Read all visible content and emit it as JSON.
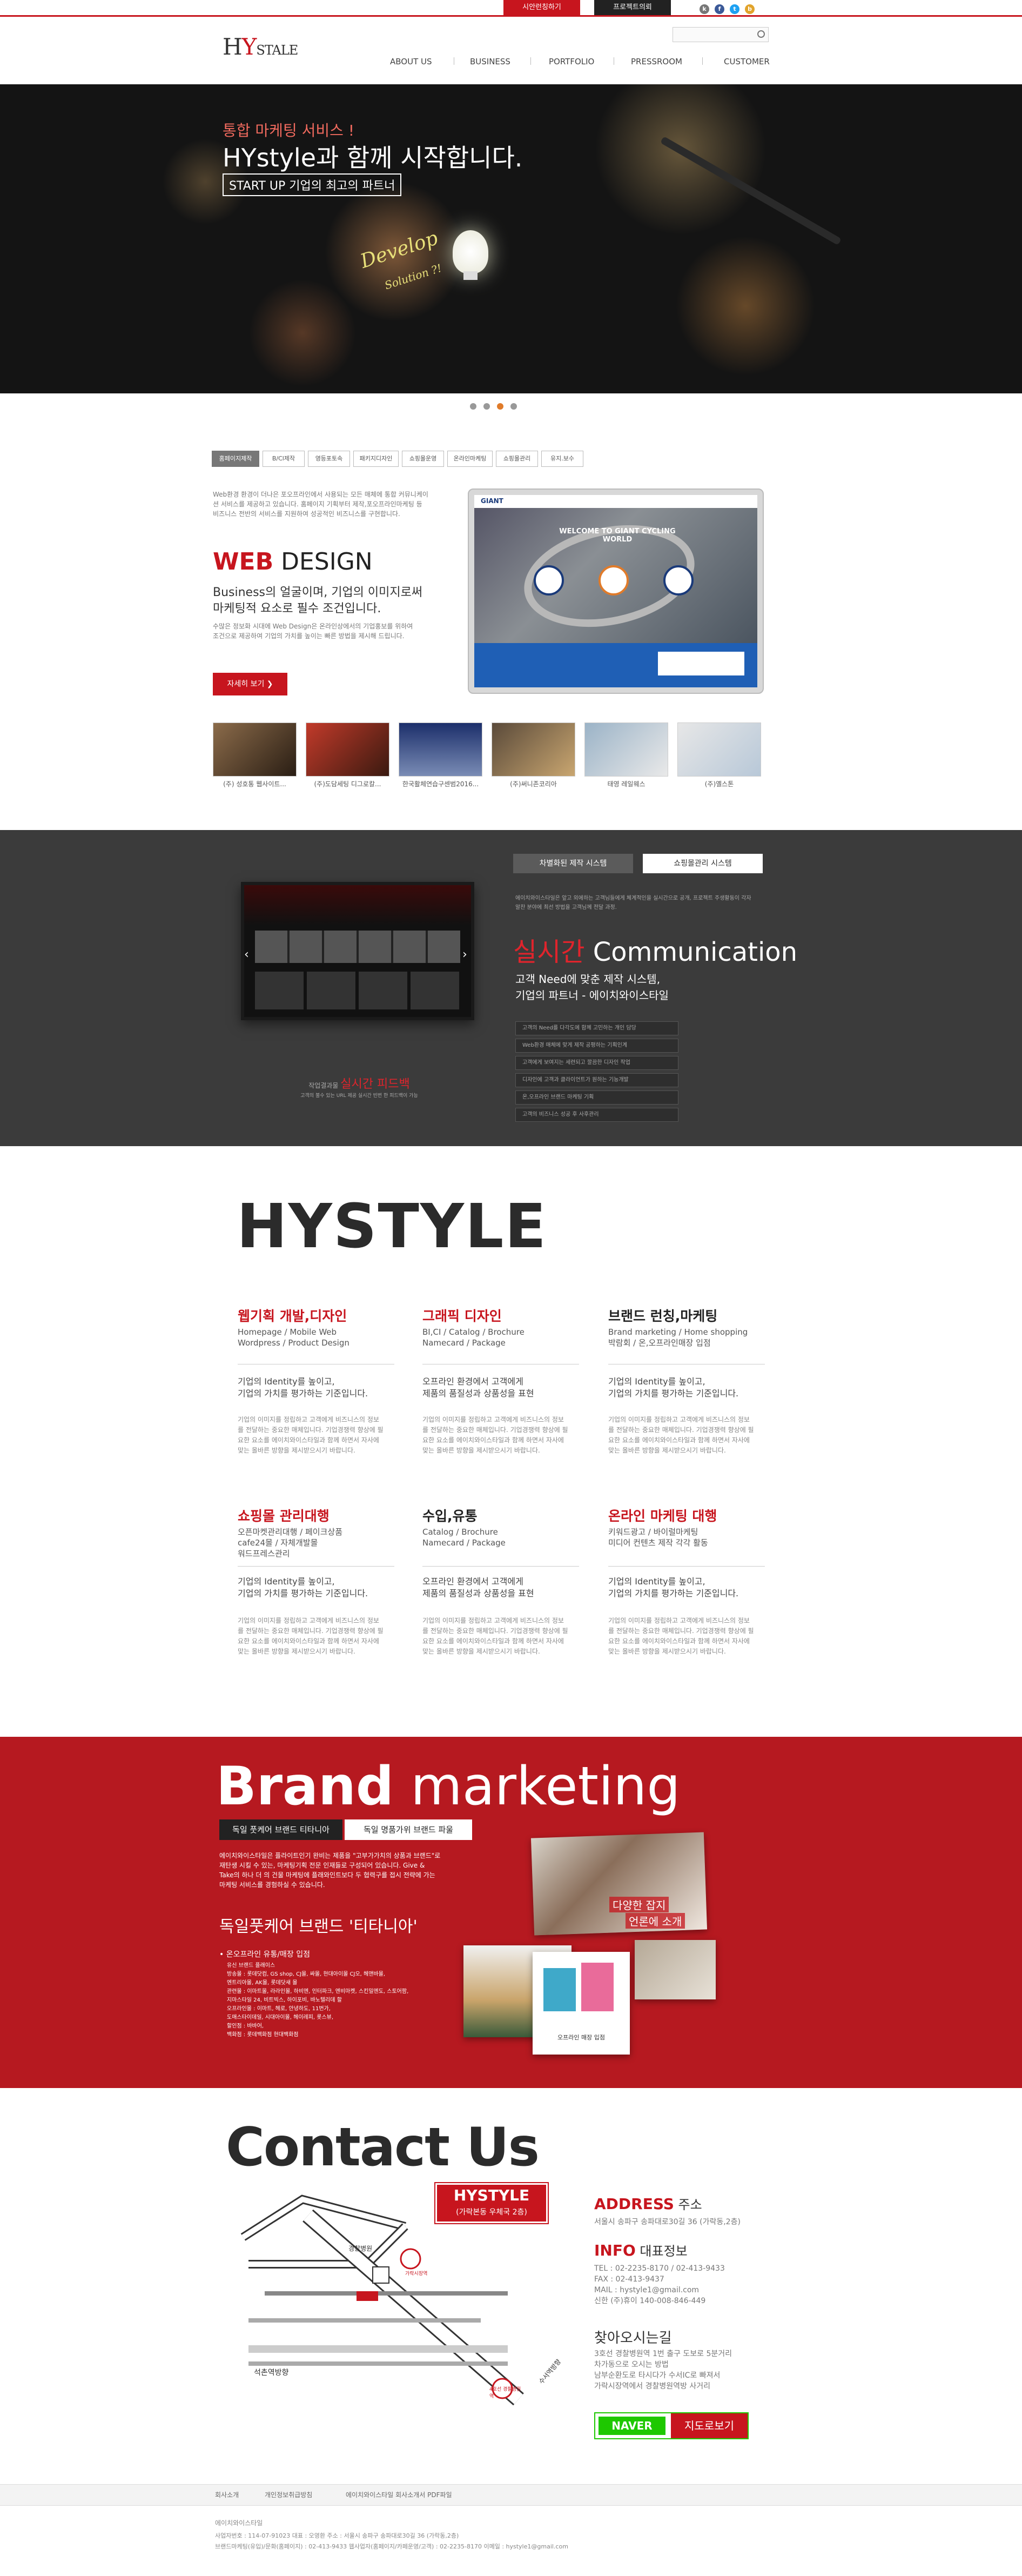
{
  "topbar": {
    "btn1": "시안런칭하기",
    "btn2": "프로젝트의뢰"
  },
  "header": {
    "logo": "HYSTYLE",
    "logo_sub": "hystyle",
    "nav": [
      "ABOUT US",
      "BUSINESS",
      "PORTFOLIO",
      "PRESSROOM",
      "CUSTOMER"
    ]
  },
  "hero": {
    "line1": "통합 마케팅 서비스 !",
    "line2": "HYstyle과 함께 시작합니다.",
    "line3": "START UP 기업의 최고의 파트너",
    "chalk": "Develop",
    "chalk2": "Solution ?!"
  },
  "web": {
    "tabs": [
      "홈페이지제작",
      "B/Cl제작",
      "영등포토속",
      "패키지디자인",
      "쇼핑몰운영",
      "온라인마케팅",
      "쇼핑몰관리",
      "유지.보수"
    ],
    "intro": "Web환경 환경이 더나은 포오프라인에서 사용되는 모든 매체에 통합 커뮤니케이션 서비스를 제공하고 있습니다. 홈페이지 기획부터 제작,포오프라인마케팅 등 비즈니스 전반의 서비스를 지원하여 성공적인 비즈니스를 구현합니다.",
    "title_red": "WEB",
    "title_rest": " DESIGN",
    "subtitle1": "Business의 얼굴이며, 기업의 이미지로써",
    "subtitle2": "마케팅적 요소로 필수 조건입니다.",
    "desc": "수많은 정보화 시대에 Web Design은 온라인상에서의 기업홍보를 위하여 조건으로 제공하여 기업의 가치를 높이는 빠른 방법을 제시해 드립니다.",
    "more": "자세히 보기 ❯",
    "screen_title": "WELCOME TO GIANT CYCLING WORLD",
    "screen_logo": "GIANT",
    "thumbs": [
      "(주) 성호통 웹사이트...",
      "(주)도담세팅 디그로칼...",
      "한국활체연습구센범2016...",
      "(주)써니존코리아",
      "태영 레일웨스",
      "(주)옐스톤"
    ]
  },
  "dark": {
    "tab1": "차별화된 제작 시스템",
    "tab2": "쇼핑몰관리 시스템",
    "desc": "에이치와이스타일은 앞고 외에하는 고객님들에게 체계적인을 실시간으로 공개, 프로젝트 주생활동이 각자 알찬 분야에 최선 방법을 고객님께 전달 과정.",
    "title_red": "실시간",
    "title_rest": " Communication",
    "sub1": "고객 Need에 맞춘 제작 시스템,",
    "sub2": "기업의 파트너 - 에이치와이스타일",
    "list": [
      "고객의 Need를 다각도에 함께 고민하는 개인 담당",
      "Web환경 매체에 맞게 제작 공평하는 기획인계",
      "고객에게 보여지는 세련되고 깔끔한 디자인 작업",
      "디자인에 고객과 클라이언트가 원하는 기능개발",
      "온,오프라인 브랜드 마케팅 기획",
      "고객의 비즈니스 성공 후 사후관리"
    ],
    "caption_pre": "작업결과물 ",
    "caption_red": "실시간 피드백",
    "caption_sub": "고객의 불수 있는 URL 제공 실시간 빈번 한 피드백이 가능"
  },
  "hystyle": {
    "title": "HYSTYLE",
    "cols": [
      {
        "h": "웹기획 개발,디자인",
        "s1": "Homepage / Mobile Web",
        "s2": "Wordpress / Product Design",
        "b1": "기업의 Identity를 높이고,",
        "b2": "기업의 가치를 평가하는 기준입니다.",
        "p": "기업의 이미지를 정립하고 고객에게 비즈니스의 정보를 전달하는 중요한 매체입니다. 기업경쟁력 향상에 필요한 요소를 에이치와이스타일과 함께 하면서 자사에 맞는 올바른 방향을 제시받으시기 바랍니다."
      },
      {
        "h": "그래픽 디자인",
        "s1": "BI,CI / Catalog / Brochure",
        "s2": "Namecard / Package",
        "b1": "오프라인 환경에서 고객에게",
        "b2": "제품의 품질성과 상품성을 표현",
        "p": "기업의 이미지를 정립하고 고객에게 비즈니스의 정보를 전달하는 중요한 매체입니다. 기업경쟁력 향상에 필요한 요소를 에이치와이스타일과 함께 하면서 자사에 맞는 올바른 방향을 제시받으시기 바랍니다."
      },
      {
        "h": "브랜드 런칭,마케팅",
        "s1": "Brand marketing / Home shopping",
        "s2": "박람회 / 온,오프라인매장 입점",
        "b1": "기업의 Identity를 높이고,",
        "b2": "기업의 가치를 평가하는 기준입니다.",
        "p": "기업의 이미지를 정립하고 고객에게 비즈니스의 정보를 전달하는 중요한 매체입니다. 기업경쟁력 향상에 필요한 요소를 에이치와이스타일과 함께 하면서 자사에 맞는 올바른 방향을 제시받으시기 바랍니다."
      },
      {
        "h": "쇼핑몰 관리대행",
        "s1": "오픈마켓관리대행 / 페이크상품",
        "s2": "cafe24몰 / 자체개발몰",
        "s3": "워드프레스관리",
        "b1": "기업의 Identity를 높이고,",
        "b2": "기업의 가치를 평가하는 기준입니다.",
        "p": "기업의 이미지를 정립하고 고객에게 비즈니스의 정보를 전달하는 중요한 매체입니다. 기업경쟁력 향상에 필요한 요소를 에이치와이스타일과 함께 하면서 자사에 맞는 올바른 방향을 제시받으시기 바랍니다."
      },
      {
        "h": "수입,유통",
        "s1": "Catalog / Brochure",
        "s2": "Namecard / Package",
        "b1": "오프라인 환경에서 고객에게",
        "b2": "제품의 품질성과 상품성을 표현",
        "p": "기업의 이미지를 정립하고 고객에게 비즈니스의 정보를 전달하는 중요한 매체입니다. 기업경쟁력 향상에 필요한 요소를 에이치와이스타일과 함께 하면서 자사에 맞는 올바른 방향을 제시받으시기 바랍니다."
      },
      {
        "h": "온라인 마케팅 대행",
        "s1": "키워드광고 / 바이럴마케팅",
        "s2": "미디어 컨텐츠 제작 각각 활동",
        "b1": "기업의 Identity를 높이고,",
        "b2": "기업의 가치를 평가하는 기준입니다.",
        "p": "기업의 이미지를 정립하고 고객에게 비즈니스의 정보를 전달하는 중요한 매체입니다. 기업경쟁력 향상에 필요한 요소를 에이치와이스타일과 함께 하면서 자사에 맞는 올바른 방향을 제시받으시기 바랍니다."
      }
    ]
  },
  "brand": {
    "title_bold": "Brand",
    "title_rest": " marketing",
    "tab1": "독일 풋케어 브랜드 티타니아",
    "tab2": "독일 명품가위 브랜드 파울",
    "intro": "에이치와이스타일은 플라이트인기 완비는 제품을 \"고부가가치의 상품과 브랜드\"로 재탄생 시킬 수 있는, 마케팅기획 전문 인재들로 구성되어 있습니다. Give & Take의 하나 더 의 건물 마케팅에 플래와인트보다 두 협력구를 접시 전략에 가는 마케팅 서비스를 경험하실 수 있습니다.",
    "sub": "독일풋케어 브랜드 '티타니아'",
    "bullet": "• 온오프라인 유통/매장 입점",
    "list": "유신 브랜드 플래이스\n방송몰 : 롯데닷컴, GS shop, CJ몰, 싸몰, 현대아이몰 CJ오, 헤앤바몰,\n엔트리아몰, AK몰, 롯데닷새 몰\n관련몰 : 이마트몰, 라라인몰, 하비엔, 인터파크, 엔비마켓, 스킨밀엔도, 스토어팜,\n지마스타일 24, 비트빅스, 하이포비, 바노텔리데 할\n오프라인몰 : 이마트, 헤로, 안녕하도, 11번가,\n도매스타이데일, 시대아이몰, 헤이레피, 롯스뷰,\n할인점 : 바바어,\n백화점 : 롯데백화점 현대백화점",
    "photo_text1": "다양한 잡지",
    "photo_text2": "언론에 소개",
    "photo_cap": "오프라인 매장 입점"
  },
  "contact": {
    "title": "Contact Us",
    "map_name": "HYSTYLE",
    "map_sub": "(가락본동 우체국 2층)",
    "map_label1": "경찰병원",
    "map_label2": "석촌역방향",
    "map_label3": "가락시장역",
    "map_label4": "수서역방향",
    "map_pin": "4호선 경찰병원역",
    "address_h": "ADDRESS",
    "address_k": " 주소",
    "address": "서울시 송파구 송파대로30길 36 (가락동,2층)",
    "info_h": "INFO",
    "info_k": " 대표정보",
    "info_lines": [
      "TEL : 02-2235-8170  /  02-413-9433",
      "FAX : 02-413-9437",
      "MAIL : hystyle1@gmail.com",
      "신한 (주)휴이 140-008-846-449"
    ],
    "way_h": "찾아오시는길",
    "way_lines": [
      "3호선 경찰병원역 1번 출구 도보로 5분거리",
      "차가동으로 오시는 방법",
      "남부순환도로 타시다가 수서IC로 빠져서",
      "가락시장역에서 경찰병원역방 사거리"
    ],
    "naver": "NAVER",
    "naver_btn": "지도로보기"
  },
  "footer": {
    "nav": [
      "회사소개",
      "개인정보취급방침",
      "에이치와이스타일 회사소개서 PDF파일"
    ],
    "company": "에이치와이스타일",
    "line1": "사업자번호 : 114-07-91023    대표 : 오영환    주소 : 서울시 송파구 송파대로30길 36 (가락동,2층)",
    "line2": "브랜드마케팅(유입)/문화(홈페이지) : 02-413-9433    웹사업자(홈페이지/카페운영/고객) : 02-2235-8170    이메일 : hystyle1@gmail.com"
  },
  "colors": {
    "accent": "#c7151e",
    "dark": "#3b3b3b",
    "brand_bg": "#b61920"
  }
}
